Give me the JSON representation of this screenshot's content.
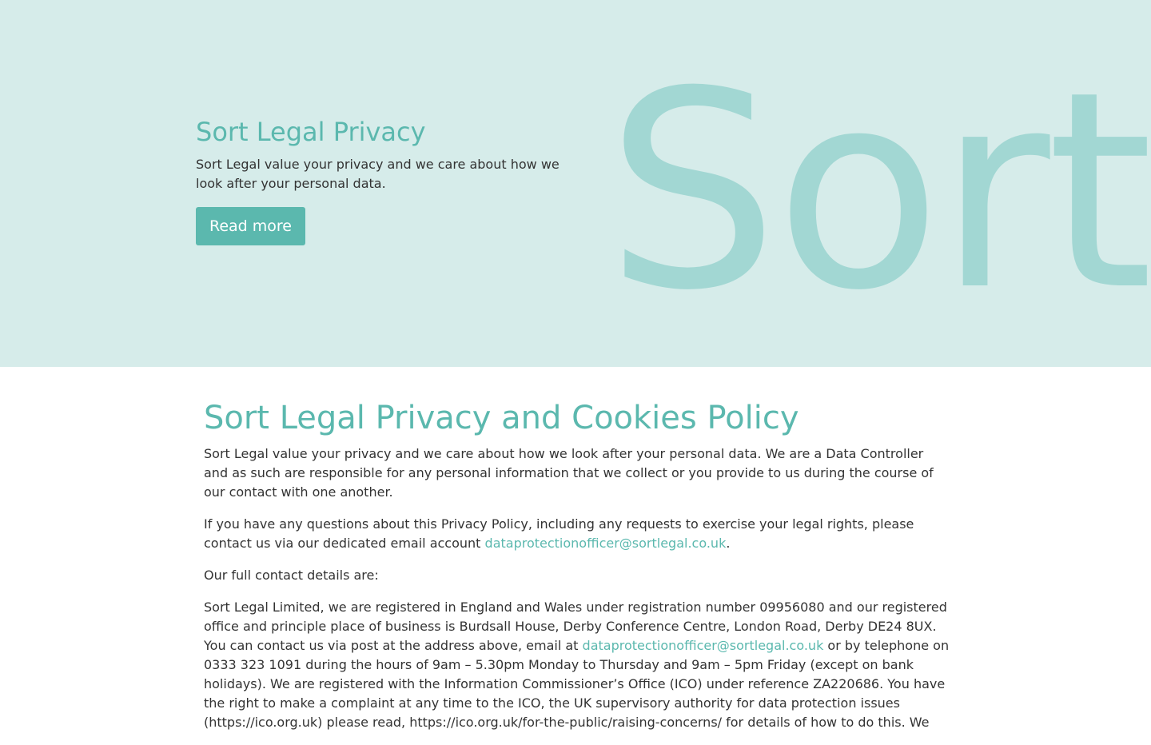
{
  "hero": {
    "background_word": "Sort",
    "title": "Sort Legal Privacy",
    "text": "Sort Legal value your privacy and we care about how we look after your personal data.",
    "button_label": "Read more"
  },
  "policy": {
    "title": "Sort Legal Privacy and Cookies Policy",
    "paragraph_1": "Sort Legal value your privacy and we care about how we look after your personal data. We are a Data Controller and as such are responsible for any personal information that we collect or you provide to us during the course of our contact with one another.",
    "paragraph_2_before": "If you have any questions about this Privacy Policy, including any requests to exercise your legal rights, please contact us via our dedicated email account ",
    "paragraph_2_link": "dataprotectionofficer@sortlegal.co.uk",
    "paragraph_2_after": ".",
    "paragraph_3": "Our full contact details are:",
    "paragraph_4_before": "Sort Legal Limited, we are registered in England and Wales under registration number 09956080 and our registered office and principle place of business is Burdsall House, Derby Conference Centre, London Road, Derby DE24 8UX. You can contact us via post at the address above, email at ",
    "paragraph_4_link": "dataprotectionofficer@sortlegal.co.uk",
    "paragraph_4_after": " or by telephone on 0333 323 1091 during the hours of 9am – 5.30pm Monday to Thursday and 9am – 5pm Friday (except on bank holidays). We are registered with the Information Commissioner’s Office (ICO) under reference ZA220686. You have the right to make a complaint at any time to the ICO, the UK supervisory authority for data protection issues (https://ico.org.uk) please read, https://ico.org.uk/for-the-public/raising-concerns/ for details of how to do this. We"
  },
  "colors": {
    "accent": "#5bb8ae",
    "hero_background": "#d6ecea",
    "hero_word": "#a2d7d3",
    "body_text": "#333333"
  }
}
